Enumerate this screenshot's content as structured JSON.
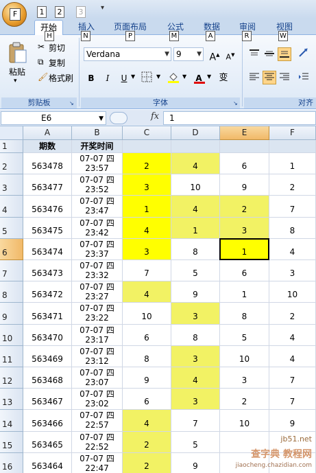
{
  "quick_access": {
    "office_key": "F",
    "keys": [
      "1",
      "2",
      "3"
    ],
    "dropdown": "▾"
  },
  "tabs": [
    {
      "label": "开始",
      "key": "H",
      "active": true
    },
    {
      "label": "插入",
      "key": "N",
      "active": false
    },
    {
      "label": "页面布局",
      "key": "P",
      "active": false
    },
    {
      "label": "公式",
      "key": "M",
      "active": false
    },
    {
      "label": "数据",
      "key": "A",
      "active": false
    },
    {
      "label": "审阅",
      "key": "R",
      "active": false
    },
    {
      "label": "视图",
      "key": "W",
      "active": false
    }
  ],
  "ribbon": {
    "clipboard": {
      "paste_label": "粘贴",
      "cut_label": "剪切",
      "copy_label": "复制",
      "format_painter_label": "格式刷",
      "group_label": "剪贴板"
    },
    "font": {
      "font_name": "Verdana",
      "font_size": "9",
      "grow_label": "A",
      "shrink_label": "A",
      "bold": "B",
      "italic": "I",
      "underline": "U",
      "font_color_glyph": "A",
      "phonetic_glyph": "变",
      "group_label": "字体"
    },
    "alignment": {
      "group_label": "对齐"
    }
  },
  "formula_bar": {
    "name_box": "E6",
    "fx": "fx",
    "value": "1"
  },
  "colors": {
    "highlight": "#ffff00",
    "highlight_light": "#f2f264",
    "header_fill": "#dbe5f1",
    "selected_header": "#f1b968"
  },
  "sheet": {
    "columns": [
      "A",
      "B",
      "C",
      "D",
      "E",
      "F"
    ],
    "selected_column": "E",
    "selected_row": "6",
    "active_cell": "E6",
    "header_row": {
      "row": "1",
      "a": "期数",
      "b": "开奖时间"
    },
    "rows": [
      {
        "row": "2",
        "a": "563478",
        "b1": "07-07 四",
        "b2": "23:57",
        "c": "2",
        "d": "4",
        "e": "6",
        "f": "1",
        "hl": [
          "c",
          "d"
        ]
      },
      {
        "row": "3",
        "a": "563477",
        "b1": "07-07 四",
        "b2": "23:52",
        "c": "3",
        "d": "10",
        "e": "9",
        "f": "2",
        "hl": [
          "c"
        ]
      },
      {
        "row": "4",
        "a": "563476",
        "b1": "07-07 四",
        "b2": "23:47",
        "c": "1",
        "d": "4",
        "e": "2",
        "f": "7",
        "hl": [
          "c",
          "d",
          "e"
        ]
      },
      {
        "row": "5",
        "a": "563475",
        "b1": "07-07 四",
        "b2": "23:42",
        "c": "4",
        "d": "1",
        "e": "3",
        "f": "8",
        "hl": [
          "c",
          "d",
          "e"
        ]
      },
      {
        "row": "6",
        "a": "563474",
        "b1": "07-07 四",
        "b2": "23:37",
        "c": "3",
        "d": "8",
        "e": "1",
        "f": "4",
        "hl": [
          "c",
          "e"
        ]
      },
      {
        "row": "7",
        "a": "563473",
        "b1": "07-07 四",
        "b2": "23:32",
        "c": "7",
        "d": "5",
        "e": "6",
        "f": "3",
        "hl": []
      },
      {
        "row": "8",
        "a": "563472",
        "b1": "07-07 四",
        "b2": "23:27",
        "c": "4",
        "d": "9",
        "e": "1",
        "f": "10",
        "hl": [
          "c"
        ]
      },
      {
        "row": "9",
        "a": "563471",
        "b1": "07-07 四",
        "b2": "23:22",
        "c": "10",
        "d": "3",
        "e": "8",
        "f": "2",
        "hl": [
          "d"
        ]
      },
      {
        "row": "10",
        "a": "563470",
        "b1": "07-07 四",
        "b2": "23:17",
        "c": "6",
        "d": "8",
        "e": "5",
        "f": "4",
        "hl": []
      },
      {
        "row": "11",
        "a": "563469",
        "b1": "07-07 四",
        "b2": "23:12",
        "c": "8",
        "d": "3",
        "e": "10",
        "f": "4",
        "hl": [
          "d"
        ]
      },
      {
        "row": "12",
        "a": "563468",
        "b1": "07-07 四",
        "b2": "23:07",
        "c": "9",
        "d": "4",
        "e": "3",
        "f": "7",
        "hl": [
          "d"
        ]
      },
      {
        "row": "13",
        "a": "563467",
        "b1": "07-07 四",
        "b2": "23:02",
        "c": "6",
        "d": "3",
        "e": "2",
        "f": "7",
        "hl": [
          "d"
        ]
      },
      {
        "row": "14",
        "a": "563466",
        "b1": "07-07 四",
        "b2": "22:57",
        "c": "4",
        "d": "7",
        "e": "10",
        "f": "9",
        "hl": [
          "c"
        ]
      },
      {
        "row": "15",
        "a": "563465",
        "b1": "07-07 四",
        "b2": "22:52",
        "c": "2",
        "d": "5",
        "e": "",
        "f": "",
        "hl": [
          "c"
        ]
      },
      {
        "row": "16",
        "a": "563464",
        "b1": "07-07 四",
        "b2": "22:47",
        "c": "2",
        "d": "9",
        "e": "",
        "f": "",
        "hl": [
          "c"
        ]
      }
    ]
  },
  "watermark": {
    "site": "jb51.net",
    "brand": "查字典 教程网",
    "url": "jiaocheng.chazidian.com"
  }
}
